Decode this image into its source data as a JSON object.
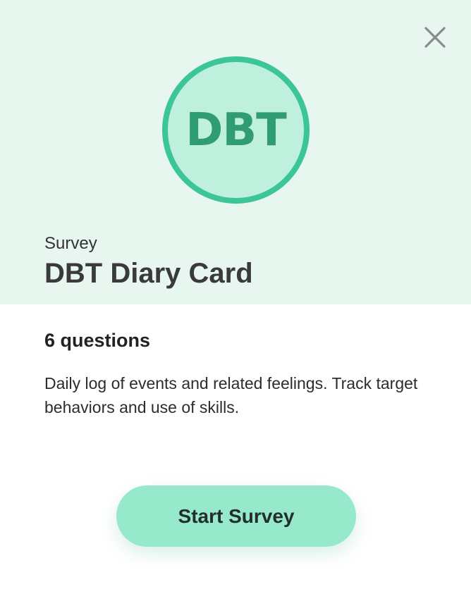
{
  "header": {
    "badge_text": "DBT",
    "kicker": "Survey",
    "title": "DBT Diary Card",
    "close_icon": "close-icon"
  },
  "body": {
    "question_count": "6 questions",
    "description": "Daily log of events and related feelings. Track target behaviors and use of skills."
  },
  "actions": {
    "start_label": "Start Survey"
  },
  "colors": {
    "hero_background": "#e7f7f0",
    "badge_border": "#3cc596",
    "badge_fill": "#bff0dd",
    "badge_text": "#2f9c76",
    "button_background": "#96e9cb"
  }
}
